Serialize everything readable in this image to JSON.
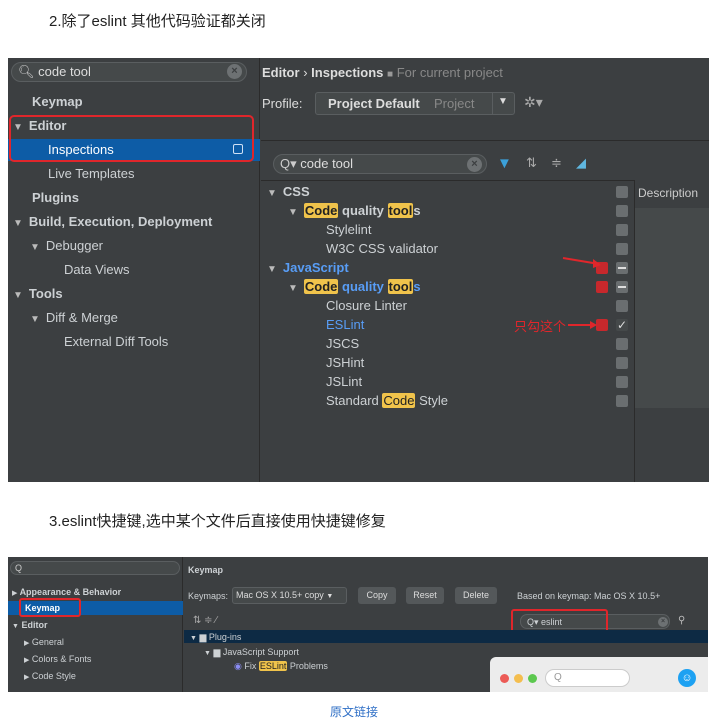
{
  "headings": {
    "step2": "2.除了eslint 其他代码验证都关闭",
    "step3": "3.eslint快捷键,选中某个文件后直接使用快捷键修复"
  },
  "shot1": {
    "search": {
      "value": "code tool"
    },
    "settings_tree": [
      {
        "label": "Keymap",
        "level": 0,
        "bold": true
      },
      {
        "label": "Editor",
        "level": 0,
        "bold": true,
        "expanded": true
      },
      {
        "label": "Inspections",
        "level": 1,
        "selected": true
      },
      {
        "label": "Live Templates",
        "level": 1
      },
      {
        "label": "Plugins",
        "level": 0,
        "bold": true
      },
      {
        "label": "Build, Execution, Deployment",
        "level": 0,
        "bold": true,
        "expanded": true
      },
      {
        "label": "Debugger",
        "level": 1,
        "expanded": true
      },
      {
        "label": "Data Views",
        "level": 2
      },
      {
        "label": "Tools",
        "level": 0,
        "bold": true,
        "expanded": true
      },
      {
        "label": "Diff & Merge",
        "level": 1,
        "expanded": true
      },
      {
        "label": "External Diff Tools",
        "level": 2
      }
    ],
    "breadcrumb": {
      "editor": "Editor",
      "sep": "›",
      "inspections": "Inspections",
      "scope": "For current project"
    },
    "profile": {
      "label": "Profile:",
      "name": "Project Default",
      "type": "Project"
    },
    "filter": {
      "value": "code tool"
    },
    "inspection_tree": {
      "css": "CSS",
      "css_group_a": "Code",
      "css_group_b": " quality ",
      "css_group_c": "tool",
      "css_group_d": "s",
      "stylelint": "Stylelint",
      "w3c": "W3C CSS validator",
      "javascript": "JavaScript",
      "js_group_a": "Code",
      "js_group_b": " quality ",
      "js_group_c": "tool",
      "js_group_d": "s",
      "closure": "Closure Linter",
      "eslint": "ESLint",
      "jscs": "JSCS",
      "jshint": "JSHint",
      "jslint": "JSLint",
      "standard_a": "Standard ",
      "standard_b": "Code",
      "standard_c": " Style"
    },
    "annotation": "只勾这个",
    "description_header": "Description"
  },
  "shot2": {
    "title": "Keymap",
    "tree": [
      "Appearance & Behavior",
      "Keymap",
      "Editor",
      "General",
      "Colors & Fonts",
      "Code Style"
    ],
    "keymaps_label": "Keymaps:",
    "keymap_value": "Mac OS X 10.5+ copy",
    "buttons": [
      "Copy",
      "Reset",
      "Delete"
    ],
    "based_on": "Based on keymap: Mac OS X 10.5+",
    "search": "eslint",
    "plugins": "Plug-ins",
    "js_support": "JavaScript Support",
    "fix_a": "Fix ",
    "fix_b": "ESLint",
    "fix_c": " Problems"
  },
  "footer": {
    "link": "原文链接"
  },
  "colors": {
    "ide_bg": "#3c3f41",
    "selection": "#0d5ca6",
    "highlight": "#f0c34b",
    "red": "#e0262b",
    "link_blue": "#589df6"
  }
}
